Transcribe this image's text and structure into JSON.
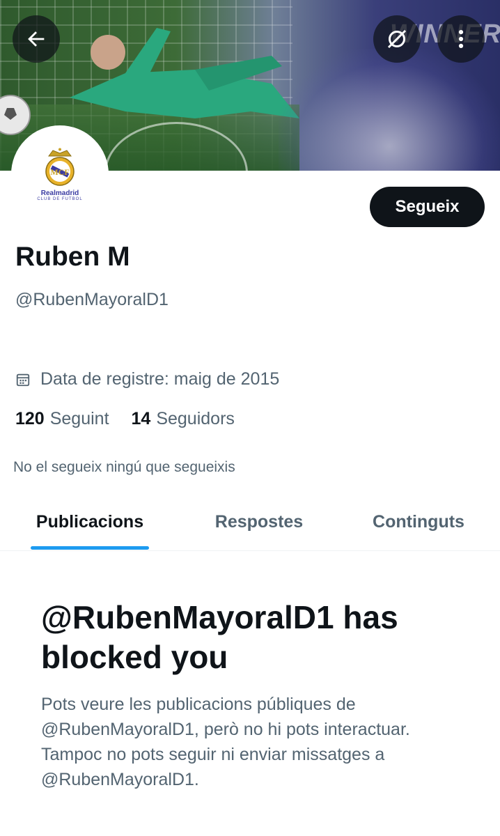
{
  "header": {
    "back_icon": "arrow-left-icon",
    "sync_icon": "slashed-circle-icon",
    "more_icon": "more-vertical-icon",
    "banner_text": "WINNERS"
  },
  "avatar": {
    "logo_text": "Realmadrid",
    "logo_subtext": "CLUB DE FUTBOL"
  },
  "profile": {
    "follow_label": "Segueix",
    "name": "Ruben M",
    "handle": "@RubenMayoralD1",
    "joined": "Data de registre: maig de 2015",
    "following_count": "120",
    "following_label": "Seguint",
    "followers_count": "14",
    "followers_label": "Seguidors",
    "mutuals_text": "No el segueix ningú que segueixis"
  },
  "tabs": [
    {
      "label": "Publicacions"
    },
    {
      "label": "Respostes"
    },
    {
      "label": "Continguts"
    }
  ],
  "blocked": {
    "title": "@RubenMayoralD1 has blocked you",
    "lines": [
      "Pots veure les publicacions públiques de",
      "@RubenMayoralD1, però no hi pots interactuar.",
      "Tampoc no pots seguir ni enviar missatges a",
      "@RubenMayoralD1."
    ]
  },
  "colors": {
    "accent": "#1d9bf0",
    "text_primary": "#0f1419",
    "text_secondary": "#536471",
    "button_bg": "#0f1419"
  }
}
